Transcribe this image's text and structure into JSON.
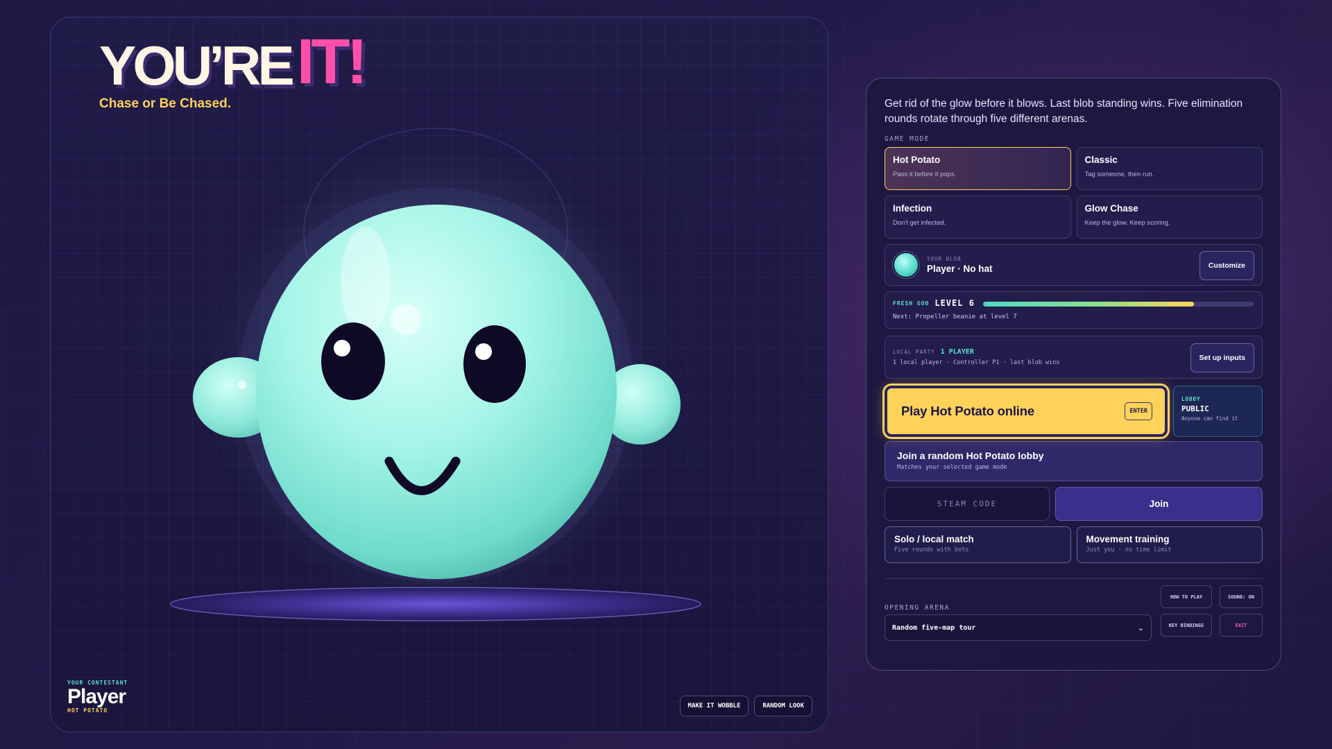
{
  "brand": {
    "logo_part1": "YOU’RE",
    "logo_part2": "IT!",
    "tagline": "Chase or Be Chased."
  },
  "contestant": {
    "label": "YOUR CONTESTANT",
    "name": "Player",
    "mode": "HOT POTATO"
  },
  "stage_actions": {
    "wobble": "MAKE IT WOBBLE",
    "random": "RANDOM LOOK"
  },
  "panel": {
    "intro": "Get rid of the glow before it blows. Last blob standing wins. Five elimination rounds rotate through five different arenas.",
    "game_mode_label": "GAME MODE",
    "modes": [
      {
        "title": "Hot Potato",
        "desc": "Pass it before it pops.",
        "selected": true
      },
      {
        "title": "Classic",
        "desc": "Tag someone, then run.",
        "selected": false
      },
      {
        "title": "Infection",
        "desc": "Don't get infected.",
        "selected": false
      },
      {
        "title": "Glow Chase",
        "desc": "Keep the glow. Keep scoring.",
        "selected": false
      }
    ],
    "blob": {
      "label": "YOUR BLOB",
      "name": "Player · No hat",
      "customize": "Customize"
    },
    "level": {
      "goo_label": "FRESH GOO",
      "level_text": "LEVEL 6",
      "progress": 0.78,
      "next": "Next: Propeller beanie at level 7"
    },
    "party": {
      "label": "LOCAL PARTY",
      "count": "1 PLAYER",
      "sub": "1 local player · Controller P1 · last blob wins",
      "setup": "Set up inputs"
    },
    "play": {
      "label": "Play Hot Potato online",
      "key": "ENTER"
    },
    "lobby": {
      "label": "LOBBY",
      "value": "PUBLIC",
      "sub": "Anyone can find it"
    },
    "join_random": {
      "title": "Join a random Hot Potato lobby",
      "sub": "Matches your selected game mode"
    },
    "steam_code_placeholder": "STEAM CODE",
    "join": "Join",
    "solo": {
      "title": "Solo / local match",
      "sub": "Five rounds with bots"
    },
    "training": {
      "title": "Movement training",
      "sub": "Just you · no time limit"
    },
    "arena_label": "OPENING ARENA",
    "arena_value": "Random five-map tour",
    "how_to_play": "HOW TO PLAY",
    "sound": "SOUND: ON",
    "key_bindings": "KEY BINDINGS",
    "exit": "EXIT"
  },
  "colors": {
    "accent_yellow": "#ffd35a",
    "accent_pink": "#ff4fa8",
    "accent_teal": "#5be0d0",
    "blob": "#9ff3e4"
  }
}
